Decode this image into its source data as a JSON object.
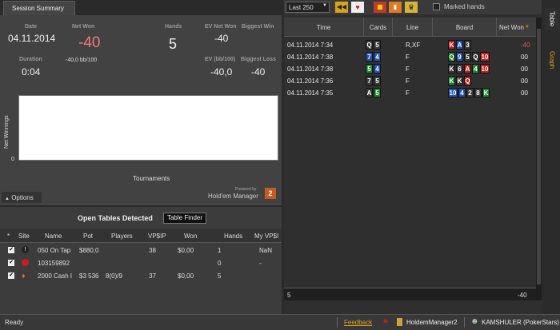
{
  "left_tab": "Session Summary",
  "summary": {
    "date_label": "Date",
    "date": "04.11.2014",
    "netwon_label": "Net Won",
    "netwon": "-40",
    "hands_label": "Hands",
    "hands": "5",
    "evnet_label": "EV Net Won",
    "evnet": "-40",
    "biggestwin_label": "Biggest Win",
    "duration_label": "Duration",
    "duration": "0:04",
    "bb": "-40,0 bb/100",
    "ev100_label": "EV (bb/100)",
    "ev100": "-40,0",
    "biggestloss_label": "Biggest Loss",
    "biggestloss": "-40"
  },
  "chart": {
    "ylabel": "Net Winnings",
    "y0": "0",
    "xlabel": "Tournaments",
    "poweredby": "Powered by",
    "hm": "Hold'em Manager",
    "options": "Options"
  },
  "open_tables": {
    "title": "Open Tables Detected",
    "finder": "Table Finder",
    "headers": [
      "*",
      "Site",
      "Name",
      "Pot",
      "Players",
      "VP$IP",
      "Won",
      "Hands",
      "My VP$I"
    ],
    "rows": [
      {
        "name": "050 On Tap",
        "pot": "$880,0",
        "players": "",
        "vpip": "38",
        "won": "$0,00",
        "hands": "1",
        "myvpip": "NaN"
      },
      {
        "name": "103159892",
        "pot": "",
        "players": "",
        "vpip": "",
        "won": "",
        "hands": "0",
        "myvpip": "-"
      },
      {
        "name": "2000 Cash I",
        "pot": "$3 536",
        "players": "8(0)/9",
        "vpip": "37",
        "won": "$0,00",
        "hands": "5",
        "myvpip": ""
      }
    ]
  },
  "toolbar": {
    "filter": "Last 250",
    "marked": "Marked hands"
  },
  "grid": {
    "headers": [
      "Time",
      "Cards",
      "Line",
      "Board",
      "Net Won"
    ],
    "rows": [
      {
        "time": "04.11.2014 7:34",
        "cards": [
          "Q",
          "5"
        ],
        "line": "R,XF",
        "board": [
          "K",
          "A",
          "3"
        ],
        "net": "-40"
      },
      {
        "time": "04.11.2014 7:38",
        "cards": [
          "7",
          "4"
        ],
        "line": "F",
        "board": [
          "Q",
          "9",
          "5",
          "Q",
          "10"
        ],
        "net": "00"
      },
      {
        "time": "04.11.2014 7:38",
        "cards": [
          "5",
          "4"
        ],
        "line": "F",
        "board": [
          "K",
          "6",
          "A",
          "4",
          "10"
        ],
        "net": "00"
      },
      {
        "time": "04.11.2014 7:36",
        "cards": [
          "7",
          "5"
        ],
        "line": "F",
        "board": [
          "K",
          "K",
          "Q"
        ],
        "net": "00"
      },
      {
        "time": "04.11.2014 7:35",
        "cards": [
          "A",
          "5"
        ],
        "line": "F",
        "board": [
          "10",
          "4",
          "2",
          "8",
          "K"
        ],
        "net": "00"
      }
    ],
    "footer_hands": "5",
    "footer_net": "-40"
  },
  "side_tabs": [
    "Table",
    "Graph"
  ],
  "status": {
    "ready": "Ready",
    "feedback": "Feedback",
    "hm2": "HoldemManager2",
    "user": "KAMSHULER (PokerStars)"
  }
}
